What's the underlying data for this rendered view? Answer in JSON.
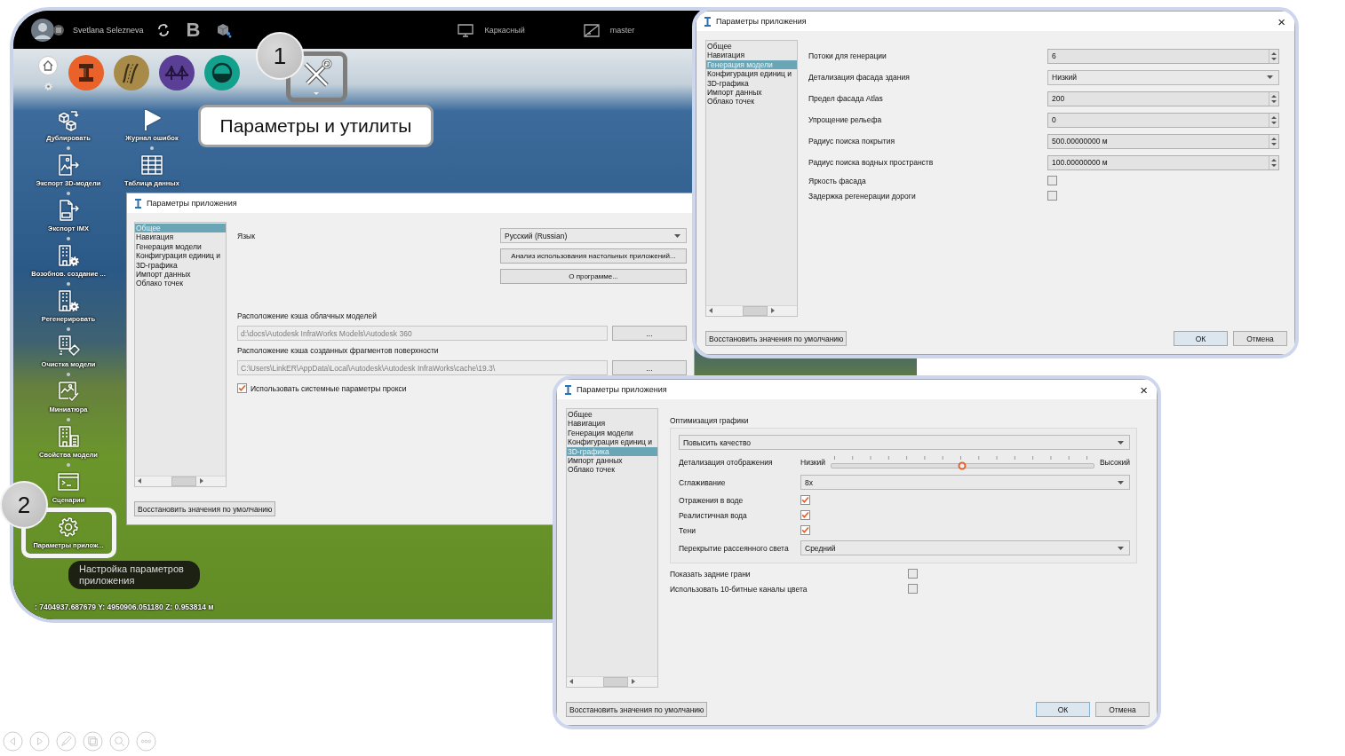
{
  "app_window": {
    "top_bar": {
      "user_name": "Svetlana Selezneva",
      "letter_button": "B",
      "view_style": "Каркасный",
      "branch": "master"
    },
    "sidebar": {
      "columns": [
        {
          "items": [
            {
              "label": "Дублировать"
            },
            {
              "label": "Экспорт 3D-модели"
            },
            {
              "label": "Экспорт IMX"
            },
            {
              "label": "Возобнов. создание ..."
            },
            {
              "label": "Регенерировать"
            },
            {
              "label": "Очистка модели"
            },
            {
              "label": "Миниатюра"
            },
            {
              "label": "Свойства модели"
            },
            {
              "label": "Сценарии"
            },
            {
              "label": "Параметры прилож..."
            }
          ]
        },
        {
          "items": [
            {
              "label": "Журнал ошибок"
            },
            {
              "label": "Таблица данных"
            }
          ]
        }
      ]
    },
    "tooltip": "Настройка параметров приложения",
    "coordinates": ": 7404937.687679 Y: 4950906.051180 Z: 0.953814 м"
  },
  "annotations": [
    {
      "number": "1",
      "callout": "Параметры и утилиты"
    },
    {
      "number": "2"
    }
  ],
  "dialogs": [
    {
      "kind": "general",
      "title": "Параметры приложения",
      "nav": [
        {
          "label": "Общее",
          "selected": true
        },
        {
          "label": "Навигация",
          "selected": false
        },
        {
          "label": "Генерация модели",
          "selected": false
        },
        {
          "label": "Конфигурация единиц и",
          "selected": false
        },
        {
          "label": "3D-графика",
          "selected": false
        },
        {
          "label": "Импорт данных",
          "selected": false
        },
        {
          "label": "Облако точек",
          "selected": false
        }
      ],
      "rows": [
        {
          "kind": "dropdown",
          "label": "Язык",
          "value": "Русский (Russian)"
        },
        {
          "kind": "button",
          "label": "Анализ использования настольных приложений..."
        },
        {
          "kind": "button",
          "label": "О программе..."
        },
        {
          "kind": "path",
          "label": "Расположение кэша облачных моделей",
          "value": "d:\\docs\\Autodesk InfraWorks Models\\Autodesk 360",
          "disabled": true,
          "button": "..."
        },
        {
          "kind": "path",
          "label": "Расположение кэша созданных фрагментов поверхности",
          "value": "C:\\Users\\LinkER\\AppData\\Local\\Autodesk\\Autodesk InfraWorks\\cache\\19.3\\",
          "disabled": true,
          "button": "..."
        },
        {
          "kind": "checkbox_inline",
          "label": "Использовать системные параметры прокси",
          "checked": true
        }
      ],
      "reset_button": "Восстановить значения по умолчанию"
    },
    {
      "kind": "model_generation",
      "title": "Параметры приложения",
      "close_button": "×",
      "nav": [
        {
          "label": "Общее",
          "selected": false
        },
        {
          "label": "Навигация",
          "selected": false
        },
        {
          "label": "Генерация модели",
          "selected": true
        },
        {
          "label": "Конфигурация единиц и",
          "selected": false
        },
        {
          "label": "3D-графика",
          "selected": false
        },
        {
          "label": "Импорт данных",
          "selected": false
        },
        {
          "label": "Облако точек",
          "selected": false
        }
      ],
      "rows": [
        {
          "kind": "spin",
          "label": "Потоки для генерации",
          "value": "6"
        },
        {
          "kind": "dropdown",
          "label": "Детализация фасада здания",
          "value": "Низкий"
        },
        {
          "kind": "spin",
          "label": "Предел фасада Atlas",
          "value": "200"
        },
        {
          "kind": "spin",
          "label": "Упрощение рельефа",
          "value": "0"
        },
        {
          "kind": "spin",
          "label": "Радиус поиска покрытия",
          "value": "500.00000000 м"
        },
        {
          "kind": "spin",
          "label": "Радиус поиска водных пространств",
          "value": "100.00000000 м"
        },
        {
          "kind": "checkbox",
          "label": "Яркость фасада",
          "checked": false
        },
        {
          "kind": "checkbox",
          "label": "Задержка регенерации дороги",
          "checked": false
        }
      ],
      "reset_button": "Восстановить значения по умолчанию",
      "buttons": [
        {
          "label": "ОК",
          "default": true
        },
        {
          "label": "Отмена",
          "default": false
        }
      ]
    },
    {
      "kind": "graphics",
      "title": "Параметры приложения",
      "close_button": "×",
      "nav": [
        {
          "label": "Общее",
          "selected": false
        },
        {
          "label": "Навигация",
          "selected": false
        },
        {
          "label": "Генерация модели",
          "selected": false
        },
        {
          "label": "Конфигурация единиц и",
          "selected": false
        },
        {
          "label": "3D-графика",
          "selected": true
        },
        {
          "label": "Импорт данных",
          "selected": false
        },
        {
          "label": "Облако точек",
          "selected": false
        }
      ],
      "rows": [
        {
          "kind": "group",
          "label": "Оптимизация графики",
          "rows": [
            {
              "kind": "dropdown",
              "value": "Повысить качество"
            },
            {
              "kind": "slider",
              "label": "Детализация отображения",
              "min_label": "Низкий",
              "max_label": "Высокий",
              "level": 0.5
            },
            {
              "kind": "dropdown",
              "label": "Сглаживание",
              "value": "8x"
            },
            {
              "kind": "checkbox",
              "label": "Отражения в воде",
              "checked": true
            },
            {
              "kind": "checkbox",
              "label": "Реалистичная вода",
              "checked": true
            },
            {
              "kind": "checkbox",
              "label": "Тени",
              "checked": true
            },
            {
              "kind": "dropdown",
              "label": "Перекрытие рассеянного света",
              "value": "Средний"
            }
          ]
        },
        {
          "kind": "checkbox",
          "label": "Показать задние грани",
          "checked": false
        },
        {
          "kind": "checkbox",
          "label": "Использовать 10-битные каналы цвета",
          "checked": false
        }
      ],
      "reset_button": "Восстановить значения по умолчанию",
      "buttons": [
        {
          "label": "ОК",
          "default": true
        },
        {
          "label": "Отмена",
          "default": false
        }
      ]
    }
  ]
}
